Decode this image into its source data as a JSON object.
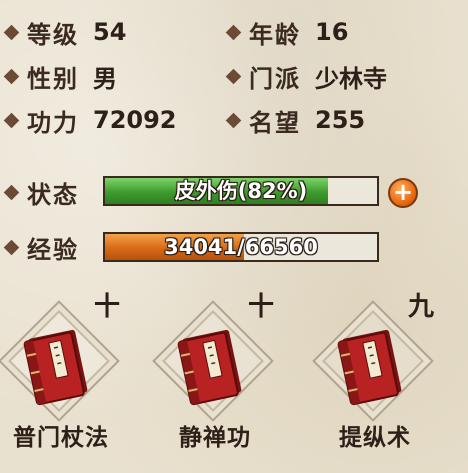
{
  "stats": {
    "level": {
      "label": "等级",
      "value": "54"
    },
    "age": {
      "label": "年龄",
      "value": "16"
    },
    "gender": {
      "label": "性别",
      "value": "男"
    },
    "sect": {
      "label": "门派",
      "value": "少林寺"
    },
    "power": {
      "label": "功力",
      "value": "72092"
    },
    "fame": {
      "label": "名望",
      "value": "255"
    }
  },
  "status_bar": {
    "label": "状态",
    "text": "皮外伤(82%)",
    "fill_fraction": 0.82,
    "color": "#3e9b2e"
  },
  "exp_bar": {
    "label": "经验",
    "text": "34041/66560",
    "current": 34041,
    "max": 66560,
    "color": "#d86a16"
  },
  "plus_button": {
    "icon": "plus-icon",
    "glyph": "+"
  },
  "skills": [
    {
      "name": "普门杖法",
      "level": "十",
      "icon": "book-icon"
    },
    {
      "name": "静禅功",
      "level": "十",
      "icon": "book-icon"
    },
    {
      "name": "提纵术",
      "level": "九",
      "icon": "book-icon"
    }
  ]
}
